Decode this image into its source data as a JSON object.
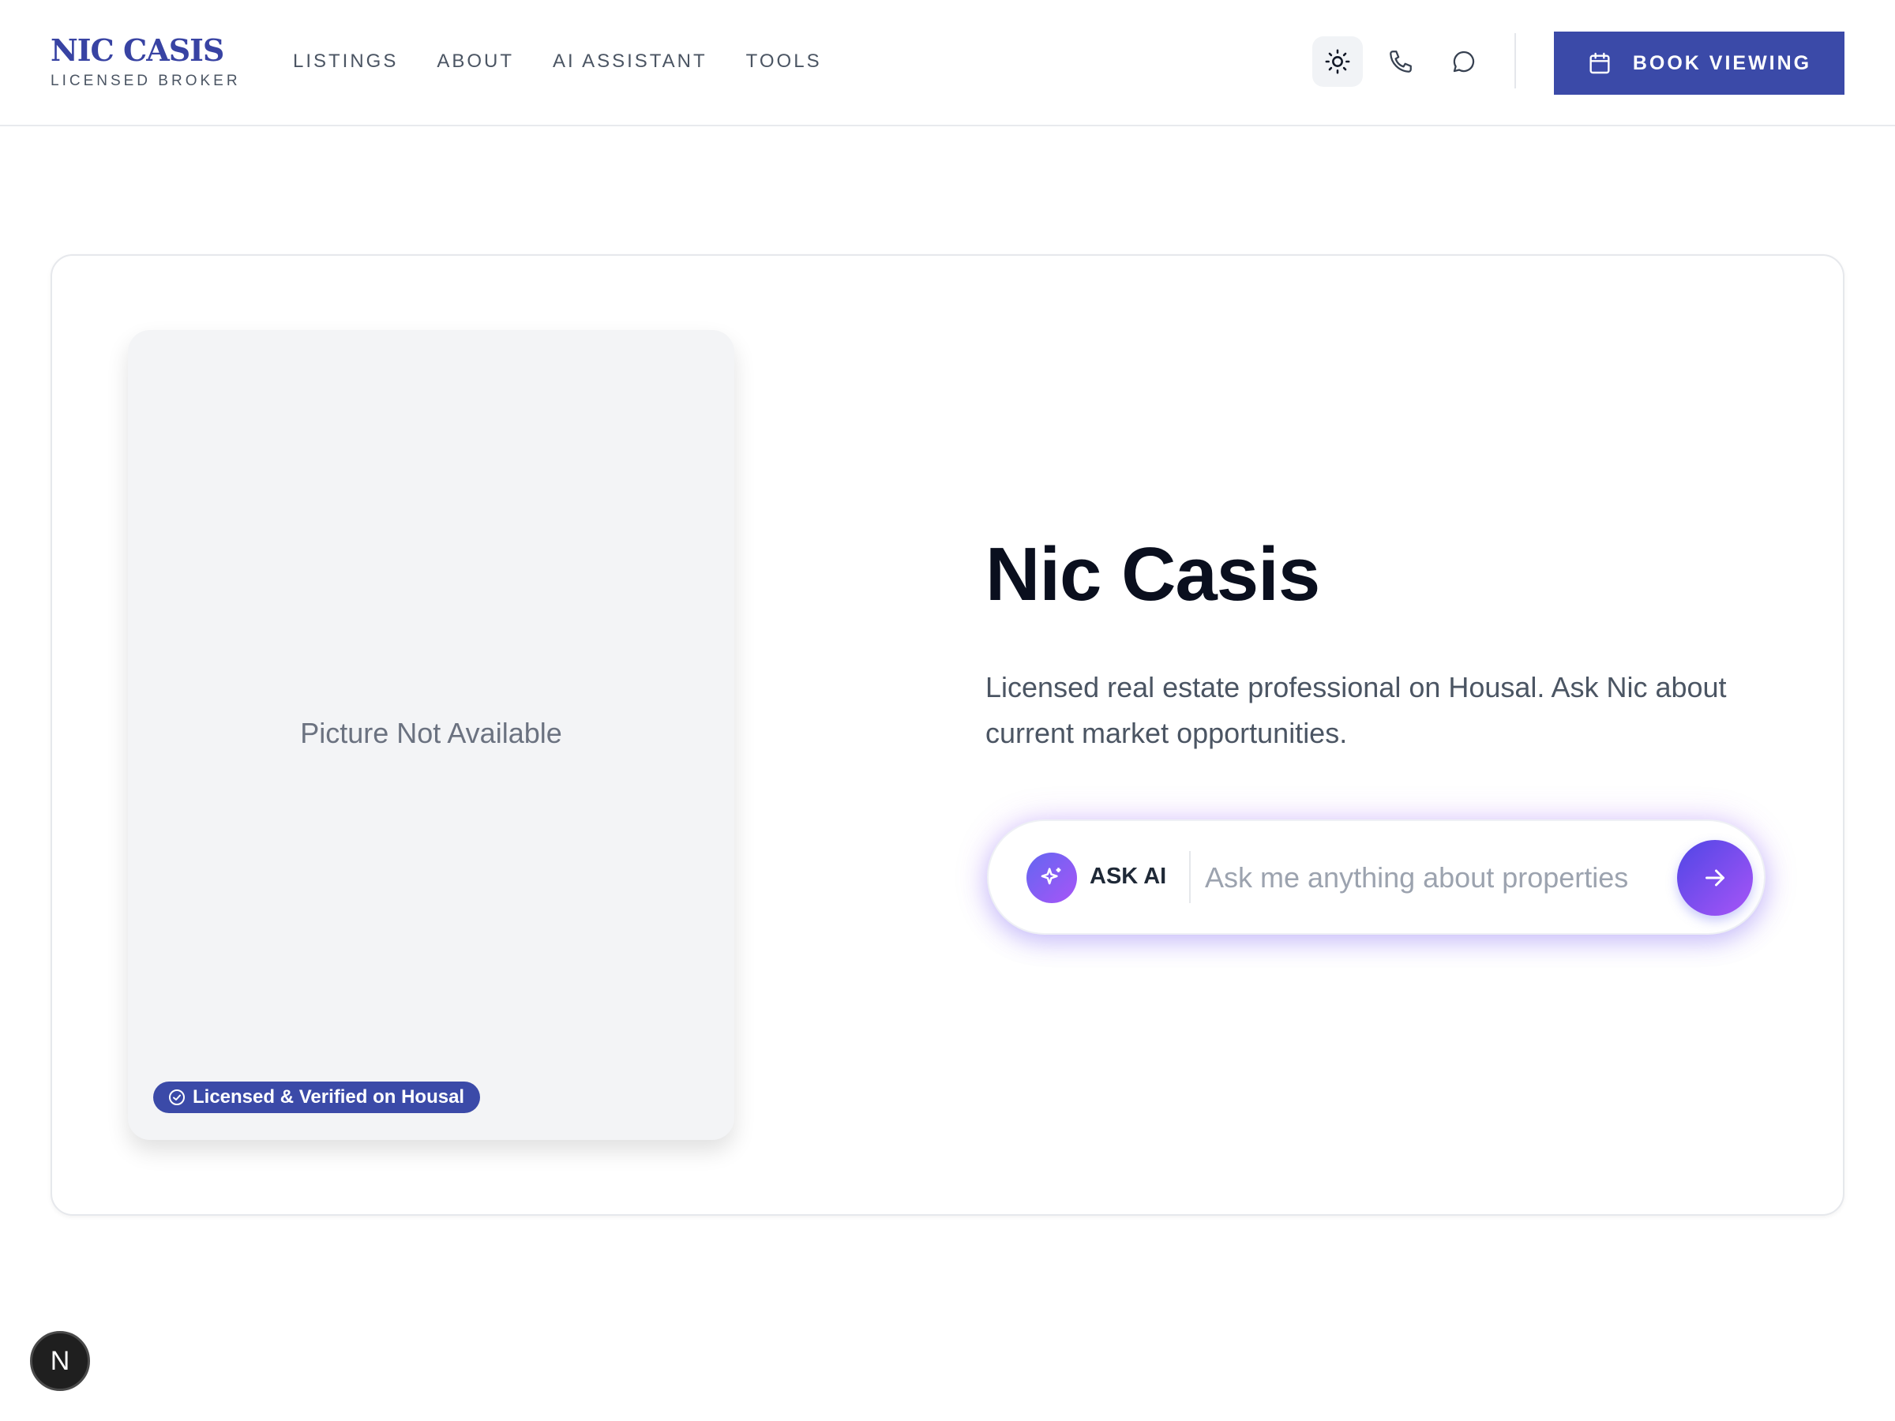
{
  "brand": {
    "name": "NIC CASIS",
    "subtitle": "LICENSED BROKER",
    "color": "#3843a3"
  },
  "nav": {
    "items": [
      "LISTINGS",
      "ABOUT",
      "AI ASSISTANT",
      "TOOLS"
    ]
  },
  "header_icons": [
    "sun-icon",
    "phone-icon",
    "chat-icon"
  ],
  "cta": {
    "label": "BOOK VIEWING",
    "icon": "calendar-icon",
    "color": "#3b4aa8"
  },
  "profile": {
    "photo_placeholder": "Picture Not Available",
    "badge": "Licensed & Verified on Housal",
    "name": "Nic Casis",
    "description": "Licensed real estate professional on Housal. Ask Nic about current market opportunities."
  },
  "ask": {
    "label": "ASK AI",
    "placeholder": "Ask me anything about properties",
    "value": ""
  },
  "dev_indicator": "N"
}
